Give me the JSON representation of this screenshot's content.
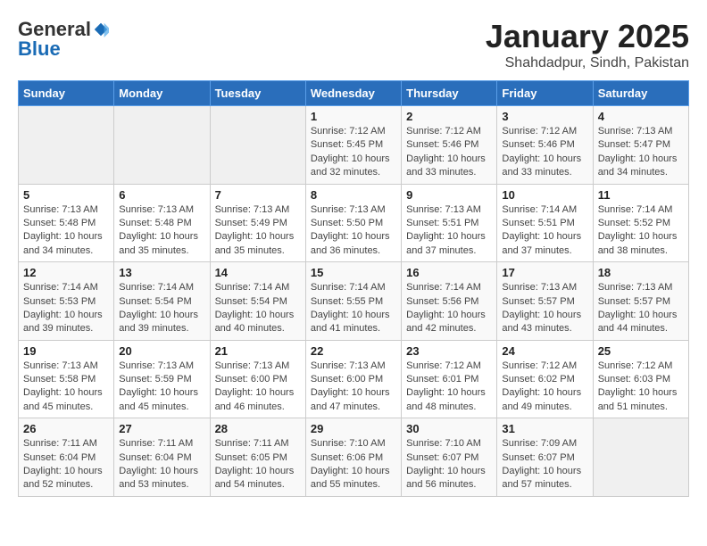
{
  "header": {
    "logo_general": "General",
    "logo_blue": "Blue",
    "title": "January 2025",
    "subtitle": "Shahdadpur, Sindh, Pakistan"
  },
  "weekdays": [
    "Sunday",
    "Monday",
    "Tuesday",
    "Wednesday",
    "Thursday",
    "Friday",
    "Saturday"
  ],
  "weeks": [
    [
      {
        "day": "",
        "info": ""
      },
      {
        "day": "",
        "info": ""
      },
      {
        "day": "",
        "info": ""
      },
      {
        "day": "1",
        "info": "Sunrise: 7:12 AM\nSunset: 5:45 PM\nDaylight: 10 hours\nand 32 minutes."
      },
      {
        "day": "2",
        "info": "Sunrise: 7:12 AM\nSunset: 5:46 PM\nDaylight: 10 hours\nand 33 minutes."
      },
      {
        "day": "3",
        "info": "Sunrise: 7:12 AM\nSunset: 5:46 PM\nDaylight: 10 hours\nand 33 minutes."
      },
      {
        "day": "4",
        "info": "Sunrise: 7:13 AM\nSunset: 5:47 PM\nDaylight: 10 hours\nand 34 minutes."
      }
    ],
    [
      {
        "day": "5",
        "info": "Sunrise: 7:13 AM\nSunset: 5:48 PM\nDaylight: 10 hours\nand 34 minutes."
      },
      {
        "day": "6",
        "info": "Sunrise: 7:13 AM\nSunset: 5:48 PM\nDaylight: 10 hours\nand 35 minutes."
      },
      {
        "day": "7",
        "info": "Sunrise: 7:13 AM\nSunset: 5:49 PM\nDaylight: 10 hours\nand 35 minutes."
      },
      {
        "day": "8",
        "info": "Sunrise: 7:13 AM\nSunset: 5:50 PM\nDaylight: 10 hours\nand 36 minutes."
      },
      {
        "day": "9",
        "info": "Sunrise: 7:13 AM\nSunset: 5:51 PM\nDaylight: 10 hours\nand 37 minutes."
      },
      {
        "day": "10",
        "info": "Sunrise: 7:14 AM\nSunset: 5:51 PM\nDaylight: 10 hours\nand 37 minutes."
      },
      {
        "day": "11",
        "info": "Sunrise: 7:14 AM\nSunset: 5:52 PM\nDaylight: 10 hours\nand 38 minutes."
      }
    ],
    [
      {
        "day": "12",
        "info": "Sunrise: 7:14 AM\nSunset: 5:53 PM\nDaylight: 10 hours\nand 39 minutes."
      },
      {
        "day": "13",
        "info": "Sunrise: 7:14 AM\nSunset: 5:54 PM\nDaylight: 10 hours\nand 39 minutes."
      },
      {
        "day": "14",
        "info": "Sunrise: 7:14 AM\nSunset: 5:54 PM\nDaylight: 10 hours\nand 40 minutes."
      },
      {
        "day": "15",
        "info": "Sunrise: 7:14 AM\nSunset: 5:55 PM\nDaylight: 10 hours\nand 41 minutes."
      },
      {
        "day": "16",
        "info": "Sunrise: 7:14 AM\nSunset: 5:56 PM\nDaylight: 10 hours\nand 42 minutes."
      },
      {
        "day": "17",
        "info": "Sunrise: 7:13 AM\nSunset: 5:57 PM\nDaylight: 10 hours\nand 43 minutes."
      },
      {
        "day": "18",
        "info": "Sunrise: 7:13 AM\nSunset: 5:57 PM\nDaylight: 10 hours\nand 44 minutes."
      }
    ],
    [
      {
        "day": "19",
        "info": "Sunrise: 7:13 AM\nSunset: 5:58 PM\nDaylight: 10 hours\nand 45 minutes."
      },
      {
        "day": "20",
        "info": "Sunrise: 7:13 AM\nSunset: 5:59 PM\nDaylight: 10 hours\nand 45 minutes."
      },
      {
        "day": "21",
        "info": "Sunrise: 7:13 AM\nSunset: 6:00 PM\nDaylight: 10 hours\nand 46 minutes."
      },
      {
        "day": "22",
        "info": "Sunrise: 7:13 AM\nSunset: 6:00 PM\nDaylight: 10 hours\nand 47 minutes."
      },
      {
        "day": "23",
        "info": "Sunrise: 7:12 AM\nSunset: 6:01 PM\nDaylight: 10 hours\nand 48 minutes."
      },
      {
        "day": "24",
        "info": "Sunrise: 7:12 AM\nSunset: 6:02 PM\nDaylight: 10 hours\nand 49 minutes."
      },
      {
        "day": "25",
        "info": "Sunrise: 7:12 AM\nSunset: 6:03 PM\nDaylight: 10 hours\nand 51 minutes."
      }
    ],
    [
      {
        "day": "26",
        "info": "Sunrise: 7:11 AM\nSunset: 6:04 PM\nDaylight: 10 hours\nand 52 minutes."
      },
      {
        "day": "27",
        "info": "Sunrise: 7:11 AM\nSunset: 6:04 PM\nDaylight: 10 hours\nand 53 minutes."
      },
      {
        "day": "28",
        "info": "Sunrise: 7:11 AM\nSunset: 6:05 PM\nDaylight: 10 hours\nand 54 minutes."
      },
      {
        "day": "29",
        "info": "Sunrise: 7:10 AM\nSunset: 6:06 PM\nDaylight: 10 hours\nand 55 minutes."
      },
      {
        "day": "30",
        "info": "Sunrise: 7:10 AM\nSunset: 6:07 PM\nDaylight: 10 hours\nand 56 minutes."
      },
      {
        "day": "31",
        "info": "Sunrise: 7:09 AM\nSunset: 6:07 PM\nDaylight: 10 hours\nand 57 minutes."
      },
      {
        "day": "",
        "info": ""
      }
    ]
  ]
}
